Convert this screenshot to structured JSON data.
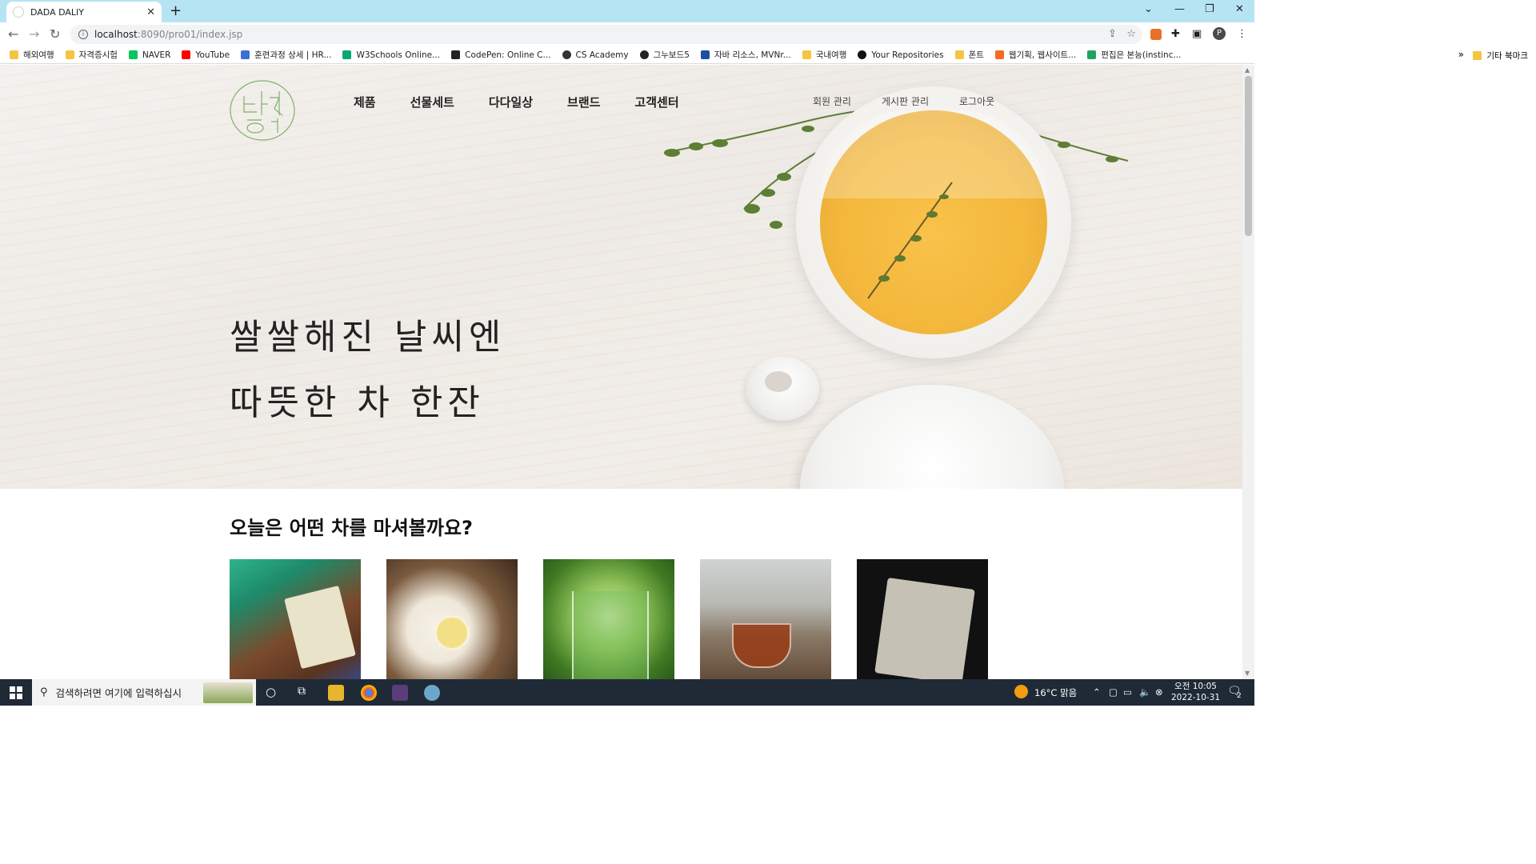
{
  "browser": {
    "tab_title": "DADA DALIY",
    "tab_close": "✕",
    "new_tab": "+",
    "url_host": "localhost",
    "url_path": ":8090/pro01/index.jsp",
    "win_min": "—",
    "win_restore": "❐",
    "win_close": "✕",
    "win_down": "⌄",
    "profile_initial": "P",
    "bookmarks": [
      {
        "label": "해외여행",
        "icon": "folder-icon"
      },
      {
        "label": "자격증시험",
        "icon": "folder-icon"
      },
      {
        "label": "NAVER",
        "icon": "naver-icon"
      },
      {
        "label": "YouTube",
        "icon": "youtube-icon"
      },
      {
        "label": "훈련과정 상세 | HR...",
        "icon": "hrd-icon"
      },
      {
        "label": "W3Schools Online...",
        "icon": "w3schools-icon"
      },
      {
        "label": "CodePen: Online C...",
        "icon": "codepen-icon"
      },
      {
        "label": "CS Academy",
        "icon": "csacademy-icon"
      },
      {
        "label": "그누보드5",
        "icon": "gnuboard-icon"
      },
      {
        "label": "자바 리소스, MVNr...",
        "icon": "mvn-icon"
      },
      {
        "label": "국내여행",
        "icon": "folder-icon"
      },
      {
        "label": "Your Repositories",
        "icon": "github-icon"
      },
      {
        "label": "폰트",
        "icon": "folder-icon"
      },
      {
        "label": "웹기획, 웹사이트...",
        "icon": "web-icon"
      },
      {
        "label": "편집은 본능(instinc...",
        "icon": "edit-icon"
      }
    ],
    "bookmarks_more": "»",
    "other_bookmarks": "기타 북마크"
  },
  "site": {
    "logo_alt": "다당",
    "nav": [
      "제품",
      "선물세트",
      "다다일상",
      "브랜드",
      "고객센터"
    ],
    "util": [
      "회원 관리",
      "게시판 관리",
      "로그아웃"
    ],
    "headline_line1": "쌀쌀해진 날씨엔",
    "headline_line2": "따뜻한 차 한잔",
    "section_title": "오늘은 어떤 차를 마셔볼까요?"
  },
  "taskbar": {
    "search_placeholder": "검색하려면 여기에 입력하십시",
    "weather": "16°C  맑음",
    "time": "오전 10:05",
    "date": "2022-10-31",
    "notif_count": "2"
  },
  "colors": {
    "tabbar": "#b7e4f3",
    "taskbar": "#1f2a36",
    "logo_green": "#7fb069"
  }
}
